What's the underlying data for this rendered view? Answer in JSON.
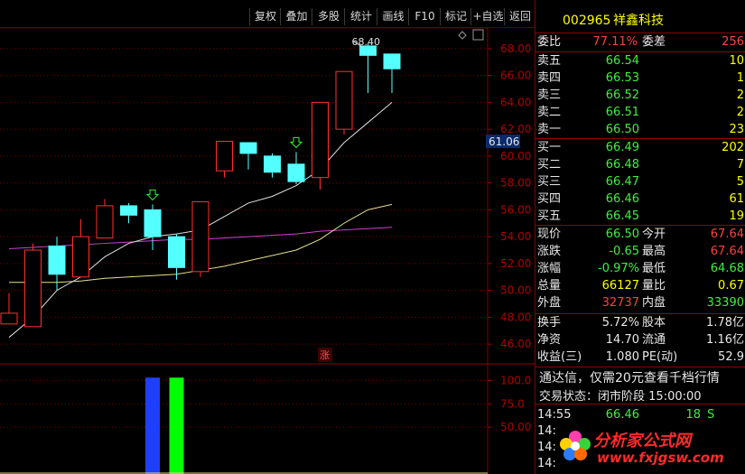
{
  "toolbar": {
    "buttons": [
      "复权",
      "叠加",
      "多股",
      "统计",
      "画线",
      "F10",
      "标记",
      "+自选",
      "返回"
    ]
  },
  "price_axis": [
    "68.00",
    "66.00",
    "64.00",
    "62.00",
    "60.00",
    "58.00",
    "56.00",
    "54.00",
    "52.00",
    "50.00",
    "48.00",
    "46.00"
  ],
  "price_marker": "61.06",
  "high_label": "68.40",
  "up_marker": "涨",
  "volume_axis": [
    "100.0",
    "75.0",
    "50.00"
  ],
  "stock": {
    "code": "002965",
    "name": "祥鑫科技"
  },
  "orderbook": {
    "weibi_label": "委比",
    "weibi_value": "77.11%",
    "weicha_label": "委差",
    "weicha_value": "256",
    "sell": [
      {
        "label": "卖五",
        "price": "66.54",
        "vol": "10"
      },
      {
        "label": "卖四",
        "price": "66.53",
        "vol": "1"
      },
      {
        "label": "卖三",
        "price": "66.52",
        "vol": "2"
      },
      {
        "label": "卖二",
        "price": "66.51",
        "vol": "2"
      },
      {
        "label": "卖一",
        "price": "66.50",
        "vol": "23"
      }
    ],
    "buy": [
      {
        "label": "买一",
        "price": "66.49",
        "vol": "202"
      },
      {
        "label": "买二",
        "price": "66.48",
        "vol": "7"
      },
      {
        "label": "买三",
        "price": "66.47",
        "vol": "5"
      },
      {
        "label": "买四",
        "price": "66.46",
        "vol": "61"
      },
      {
        "label": "买五",
        "price": "66.45",
        "vol": "19"
      }
    ]
  },
  "quote": {
    "rows": [
      {
        "l1": "现价",
        "v1": "66.50",
        "c1": "green",
        "l2": "今开",
        "v2": "67.64",
        "c2": "red"
      },
      {
        "l1": "涨跌",
        "v1": "-0.65",
        "c1": "green",
        "l2": "最高",
        "v2": "67.64",
        "c2": "red"
      },
      {
        "l1": "涨幅",
        "v1": "-0.97%",
        "c1": "green",
        "l2": "最低",
        "v2": "64.68",
        "c2": "green"
      },
      {
        "l1": "总量",
        "v1": "66127",
        "c1": "yellow",
        "l2": "量比",
        "v2": "0.67",
        "c2": "yellow"
      },
      {
        "l1": "外盘",
        "v1": "32737",
        "c1": "red",
        "l2": "内盘",
        "v2": "33390",
        "c2": "green"
      }
    ],
    "rows2": [
      {
        "l1": "换手",
        "v1": "5.72%",
        "l2": "股本",
        "v2": "1.78亿"
      },
      {
        "l1": "净资",
        "v1": "14.70",
        "l2": "流通",
        "v2": "1.16亿"
      },
      {
        "l1": "收益(三)",
        "v1": "1.080",
        "l2": "PE(动)",
        "v2": "52.9"
      }
    ]
  },
  "promo_text": "通达信，仅需20元查看千档行情",
  "trade_status": {
    "label": "交易状态：闭市阶段",
    "time": "15:00:00"
  },
  "ticks": [
    {
      "time": "14:55",
      "price": "66.46",
      "vol": "18",
      "flag": "S"
    },
    {
      "time": "14:",
      "price": "",
      "vol": "",
      "flag": ""
    },
    {
      "time": "14:",
      "price": "",
      "vol": "",
      "flag": ""
    },
    {
      "time": "14:",
      "price": "",
      "vol": "",
      "flag": ""
    }
  ],
  "watermark": {
    "text": "分析家公式网",
    "url": "www.fxjgsw.com"
  },
  "chart_data": {
    "type": "candlestick",
    "ylim": [
      45,
      69
    ],
    "candles": [
      {
        "o": 47.5,
        "c": 48.3,
        "h": 49.8,
        "l": 47.5
      },
      {
        "o": 47.3,
        "c": 53.0,
        "h": 53.5,
        "l": 47.3
      },
      {
        "o": 53.3,
        "c": 51.2,
        "h": 54.0,
        "l": 50.0
      },
      {
        "o": 51.0,
        "c": 54.0,
        "h": 55.3,
        "l": 51.0
      },
      {
        "o": 53.9,
        "c": 56.3,
        "h": 56.8,
        "l": 53.9
      },
      {
        "o": 56.3,
        "c": 55.6,
        "h": 56.5,
        "l": 55.0
      },
      {
        "o": 56.0,
        "c": 54.0,
        "h": 56.4,
        "l": 53.0
      },
      {
        "o": 54.0,
        "c": 51.7,
        "h": 54.2,
        "l": 50.8
      },
      {
        "o": 51.4,
        "c": 56.6,
        "h": 56.6,
        "l": 51.0
      },
      {
        "o": 58.9,
        "c": 61.1,
        "h": 61.1,
        "l": 58.4
      },
      {
        "o": 61.0,
        "c": 60.2,
        "h": 61.0,
        "l": 59.0
      },
      {
        "o": 60.0,
        "c": 58.8,
        "h": 60.2,
        "l": 58.4
      },
      {
        "o": 59.4,
        "c": 58.1,
        "h": 60.3,
        "l": 57.9
      },
      {
        "o": 58.4,
        "c": 64.0,
        "h": 64.0,
        "l": 57.5
      },
      {
        "o": 62.0,
        "c": 66.3,
        "h": 66.3,
        "l": 61.6
      },
      {
        "o": 68.2,
        "c": 67.5,
        "h": 68.4,
        "l": 64.7
      },
      {
        "o": 67.6,
        "c": 66.5,
        "h": 67.6,
        "l": 64.7
      }
    ],
    "ma_white": [
      46.5,
      48.0,
      50.0,
      51.0,
      52.5,
      53.5,
      54.0,
      54.2,
      54.5,
      55.5,
      56.5,
      57.0,
      57.8,
      59.0,
      61.0,
      62.5,
      64.0
    ],
    "ma_yellow": [
      50.6,
      50.6,
      50.6,
      50.7,
      50.9,
      51.0,
      51.1,
      51.2,
      51.5,
      51.8,
      52.2,
      52.6,
      53.0,
      53.8,
      55.0,
      56.0,
      56.4
    ],
    "ma_magenta": [
      53.1,
      53.2,
      53.3,
      53.4,
      53.5,
      53.6,
      53.7,
      53.8,
      53.8,
      53.9,
      54.0,
      54.1,
      54.2,
      54.4,
      54.5,
      54.6,
      54.7
    ],
    "volume_bars": [
      {
        "index": 6,
        "value": 103,
        "color": "#1f3fff"
      },
      {
        "index": 7,
        "value": 103,
        "color": "#00ff00"
      }
    ],
    "volume_ylim": [
      0,
      110
    ]
  }
}
